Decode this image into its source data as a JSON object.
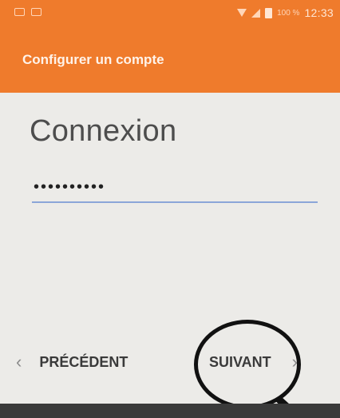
{
  "status_bar": {
    "battery_percent": "100 %",
    "time": "12:33",
    "icons": [
      "notification-icon",
      "mail-icon",
      "wifi-icon",
      "signal-icon",
      "battery-icon"
    ]
  },
  "app_bar": {
    "title": "Configurer un compte",
    "color": "#ef7b2c"
  },
  "main": {
    "heading": "Connexion",
    "password_value": "••••••••••"
  },
  "nav": {
    "prev_label": "PRÉCÉDENT",
    "next_label": "SUIVANT",
    "prev_icon": "chevron-left-icon",
    "next_icon": "chevron-right-icon"
  }
}
